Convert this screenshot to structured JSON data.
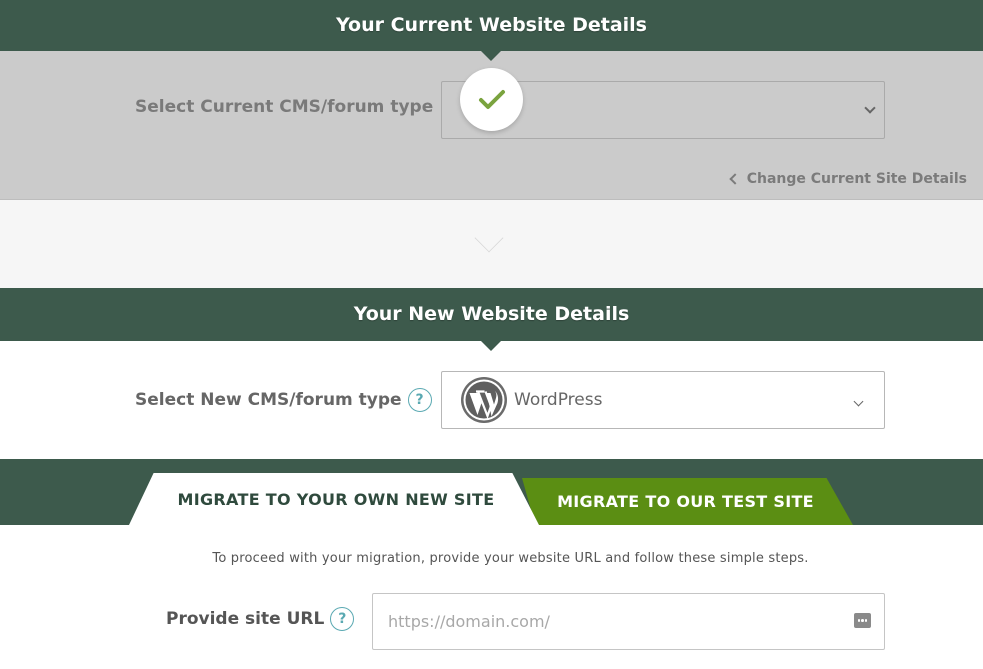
{
  "current_section": {
    "title": "Your Current Website Details",
    "cms_label": "Select Current CMS/forum type",
    "change_link": "Change Current Site Details"
  },
  "new_section": {
    "title": "Your New Website Details",
    "cms_label": "Select New CMS/forum type",
    "help_glyph": "?",
    "selected_cms": "WordPress"
  },
  "tabs": {
    "own_site": "MIGRATE TO YOUR OWN NEW SITE",
    "test_site": "MIGRATE TO OUR TEST SITE"
  },
  "migration": {
    "instructions": "To proceed with your migration, provide your website URL and follow these simple steps.",
    "url_label": "Provide site URL",
    "url_placeholder": "https://domain.com/"
  },
  "colors": {
    "header_bg": "#3d5a4c",
    "test_tab_bg": "#5b8e13",
    "check_color": "#7aa33e",
    "help_color": "#5aa9b2"
  },
  "icons": [
    "check-icon",
    "chevron-down-icon",
    "chevron-left-icon",
    "wordpress-icon",
    "help-icon",
    "password-manager-icon"
  ]
}
